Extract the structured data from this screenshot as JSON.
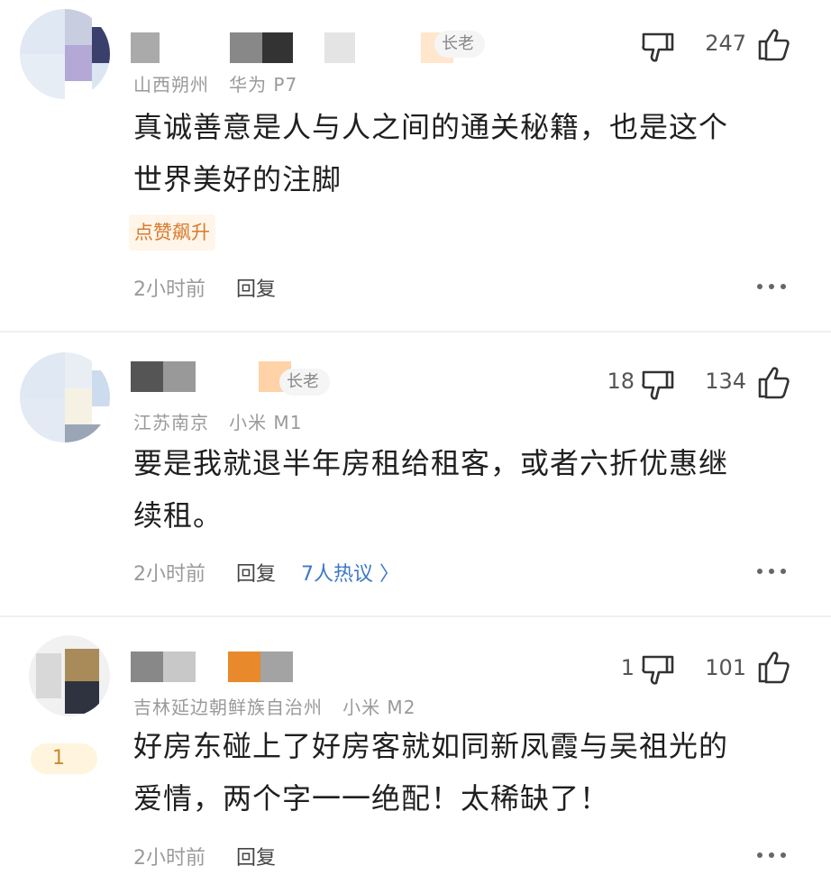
{
  "comments": [
    {
      "badge": "长老",
      "location": "山西朔州",
      "device": "华为 P7",
      "text_line1": "真诚善意是人与人之间的通关秘籍，也是这个",
      "text_line2": "世界美好的注脚",
      "tag": "点赞飙升",
      "time": "2小时前",
      "reply": "回复",
      "dislikes": "",
      "likes": "247"
    },
    {
      "badge": "长老",
      "location": "江苏南京",
      "device": "小米 M1",
      "text_line1": "要是我就退半年房租给租客，或者六折优惠继",
      "text_line2": "续租。",
      "time": "2小时前",
      "reply": "回复",
      "hot": "7人热议 〉",
      "dislikes": "18",
      "likes": "134"
    },
    {
      "location": "吉林延边朝鲜族自治州",
      "device": "小米 M2",
      "level": "1",
      "text_line1": "好房东碰上了好房客就如同新凤霞与吴祖光的",
      "text_line2": "爱情，两个字一一绝配！太稀缺了！",
      "time": "2小时前",
      "reply": "回复",
      "dislikes": "1",
      "likes": "101"
    }
  ],
  "icons": {
    "dislike": "thumbs-down-icon",
    "like": "thumbs-up-icon",
    "more": "more-dots-icon"
  },
  "colors": {
    "tag_text": "#d9792c",
    "tag_bg": "#fff5e9",
    "link": "#3c78c8"
  }
}
